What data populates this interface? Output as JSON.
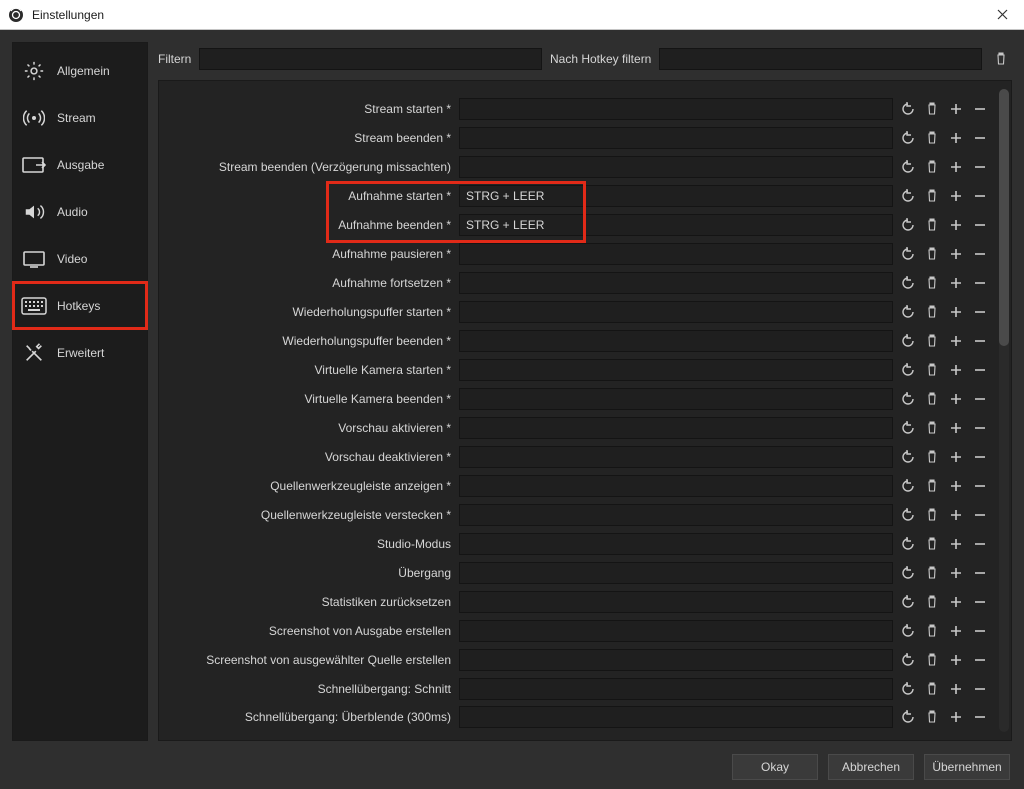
{
  "window": {
    "title": "Einstellungen"
  },
  "sidebar": {
    "items": [
      {
        "label": "Allgemein",
        "icon": "gear"
      },
      {
        "label": "Stream",
        "icon": "stream"
      },
      {
        "label": "Ausgabe",
        "icon": "output"
      },
      {
        "label": "Audio",
        "icon": "audio"
      },
      {
        "label": "Video",
        "icon": "video"
      },
      {
        "label": "Hotkeys",
        "icon": "keyboard",
        "highlighted": true
      },
      {
        "label": "Erweitert",
        "icon": "tools"
      }
    ]
  },
  "filters": {
    "filter_label": "Filtern",
    "filter_value": "",
    "hotkey_filter_label": "Nach Hotkey filtern",
    "hotkey_filter_value": ""
  },
  "hotkeys": [
    {
      "label": "Stream starten *",
      "value": ""
    },
    {
      "label": "Stream beenden *",
      "value": ""
    },
    {
      "label": "Stream beenden (Verzögerung missachten)",
      "value": ""
    },
    {
      "label": "Aufnahme starten *",
      "value": "STRG + LEER",
      "highlighted": true
    },
    {
      "label": "Aufnahme beenden *",
      "value": "STRG + LEER",
      "highlighted": true
    },
    {
      "label": "Aufnahme pausieren *",
      "value": ""
    },
    {
      "label": "Aufnahme fortsetzen *",
      "value": ""
    },
    {
      "label": "Wiederholungspuffer starten *",
      "value": ""
    },
    {
      "label": "Wiederholungspuffer beenden *",
      "value": ""
    },
    {
      "label": "Virtuelle Kamera starten *",
      "value": ""
    },
    {
      "label": "Virtuelle Kamera beenden *",
      "value": ""
    },
    {
      "label": "Vorschau aktivieren *",
      "value": ""
    },
    {
      "label": "Vorschau deaktivieren *",
      "value": ""
    },
    {
      "label": "Quellenwerkzeugleiste anzeigen *",
      "value": ""
    },
    {
      "label": "Quellenwerkzeugleiste verstecken *",
      "value": ""
    },
    {
      "label": "Studio-Modus",
      "value": ""
    },
    {
      "label": "Übergang",
      "value": ""
    },
    {
      "label": "Statistiken zurücksetzen",
      "value": ""
    },
    {
      "label": "Screenshot von Ausgabe erstellen",
      "value": ""
    },
    {
      "label": "Screenshot von ausgewählter Quelle erstellen",
      "value": ""
    },
    {
      "label": "Schnellübergang: Schnitt",
      "value": ""
    },
    {
      "label": "Schnellübergang: Überblende (300ms)",
      "value": ""
    }
  ],
  "footer": {
    "ok": "Okay",
    "cancel": "Abbrechen",
    "apply": "Übernehmen"
  }
}
